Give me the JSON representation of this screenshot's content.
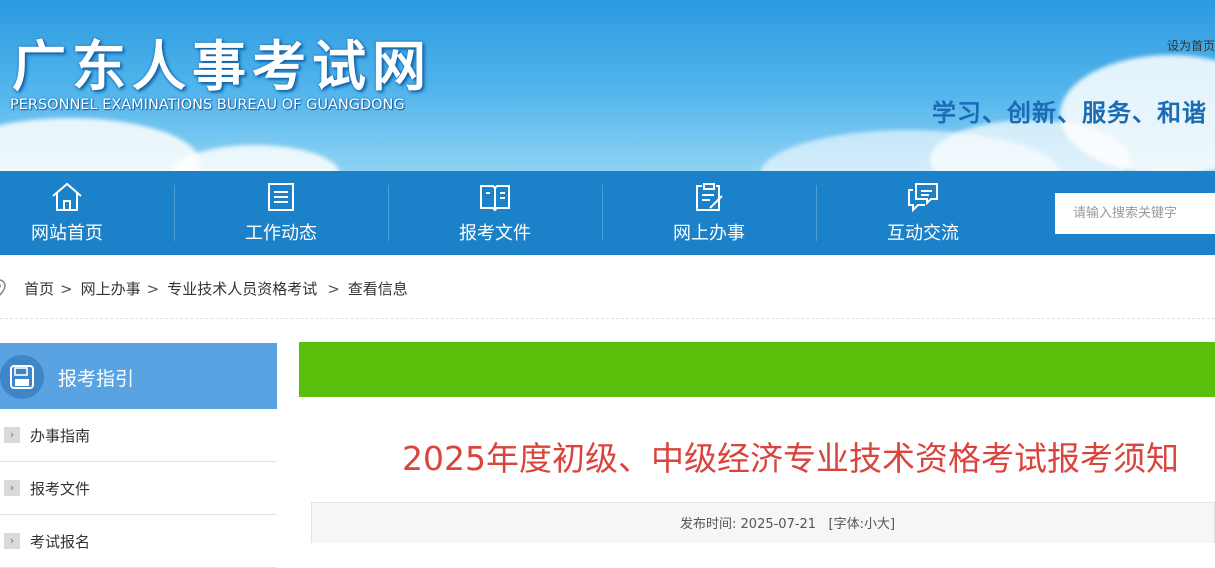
{
  "header": {
    "title": "广东人事考试网",
    "subtitle": "PERSONNEL EXAMINATIONS BUREAU OF GUANGDONG",
    "top_link": "设为首页",
    "slogan": "学习、创新、服务、和谐"
  },
  "nav": {
    "items": [
      {
        "label": "网站首页",
        "icon": "home-icon"
      },
      {
        "label": "工作动态",
        "icon": "list-icon"
      },
      {
        "label": "报考文件",
        "icon": "book-icon"
      },
      {
        "label": "网上办事",
        "icon": "edit-icon"
      },
      {
        "label": "互动交流",
        "icon": "chat-icon"
      }
    ],
    "search_placeholder": "请输入搜索关键字"
  },
  "breadcrumb": [
    "首页",
    "网上办事",
    "专业技术人员资格考试",
    "查看信息"
  ],
  "sidebar": {
    "title": "报考指引",
    "items": [
      "办事指南",
      "报考文件",
      "考试报名"
    ]
  },
  "article": {
    "title": "2025年度初级、中级经济专业技术资格考试报考须知",
    "publish_label": "发布时间:",
    "publish_date": "2025-07-21",
    "font_label": "[字体:",
    "font_small": "小",
    "font_large": "大]"
  },
  "colors": {
    "nav_bg": "#1b81c8",
    "sidebar_head": "#5aa3e2",
    "green_bar": "#59bf0a",
    "title_red": "#d9453d"
  }
}
